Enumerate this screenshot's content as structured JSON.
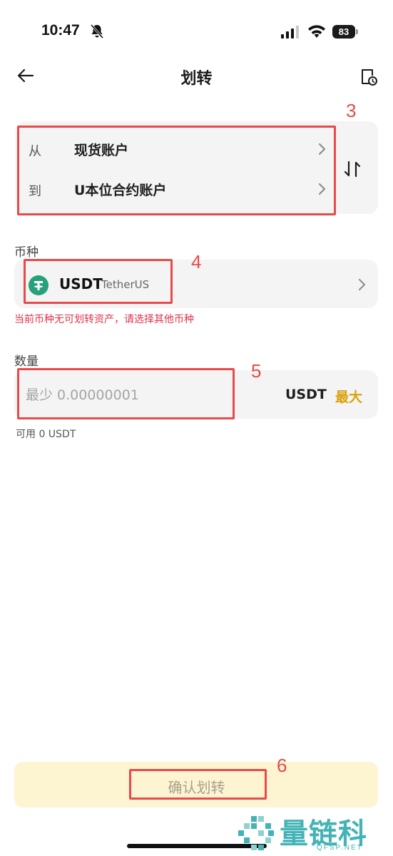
{
  "status_bar": {
    "time": "10:47",
    "battery": "83"
  },
  "header": {
    "title": "划转"
  },
  "transfer": {
    "from_label": "从",
    "from_value": "现货账户",
    "to_label": "到",
    "to_value": "U本位合约账户"
  },
  "coin": {
    "section_label": "币种",
    "symbol": "USDT",
    "name": "TetherUS",
    "warning": "当前币种无可划转资产，请选择其他币种"
  },
  "amount": {
    "section_label": "数量",
    "placeholder": "最少 0.00000001",
    "unit": "USDT",
    "max_label": "最大",
    "available": "可用 0 USDT"
  },
  "confirm_button": {
    "label": "确认划转"
  },
  "annotations": [
    "3",
    "4",
    "5",
    "6"
  ],
  "watermark": {
    "text": "量链科技",
    "sub": "QFSP.NET"
  },
  "colors": {
    "accent": "#d9a30d",
    "warning": "#e0334a",
    "annotation": "#e84a4a",
    "tether": "#26a17b",
    "watermark": "#43b3b6"
  }
}
